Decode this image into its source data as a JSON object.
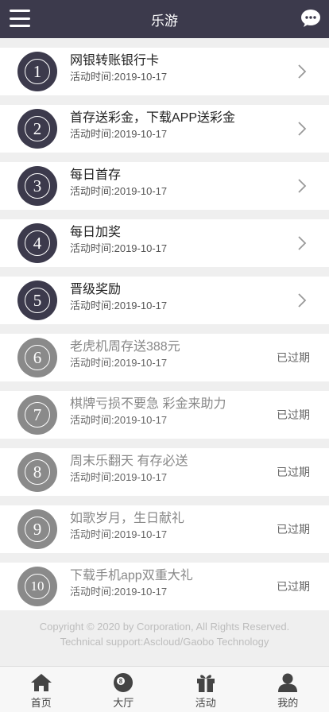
{
  "header": {
    "title": "乐游",
    "menu_icon": "menu-icon",
    "chat_icon": "chat-bubble-icon"
  },
  "promotions": [
    {
      "number": "1",
      "title": "网银转账银行卡",
      "date": "活动时间:2019-10-17",
      "status": "active"
    },
    {
      "number": "2",
      "title": "首存送彩金，下载APP送彩金",
      "date": "活动时间:2019-10-17",
      "status": "active"
    },
    {
      "number": "3",
      "title": "每日首存",
      "date": "活动时间:2019-10-17",
      "status": "active"
    },
    {
      "number": "4",
      "title": "每日加奖",
      "date": "活动时间:2019-10-17",
      "status": "active"
    },
    {
      "number": "5",
      "title": "晋级奖励",
      "date": "活动时间:2019-10-17",
      "status": "active"
    },
    {
      "number": "6",
      "title": "老虎机周存送388元",
      "date": "活动时间:2019-10-17",
      "status": "expired",
      "badge": "已过期"
    },
    {
      "number": "7",
      "title": "棋牌亏损不要急 彩金来助力",
      "date": "活动时间:2019-10-17",
      "status": "expired",
      "badge": "已过期"
    },
    {
      "number": "8",
      "title": "周末乐翻天 有存必送",
      "date": "活动时间:2019-10-17",
      "status": "expired",
      "badge": "已过期"
    },
    {
      "number": "9",
      "title": "如歌岁月，生日献礼",
      "date": "活动时间:2019-10-17",
      "status": "expired",
      "badge": "已过期"
    },
    {
      "number": "10",
      "title": "下载手机app双重大礼",
      "date": "活动时间:2019-10-17",
      "status": "expired",
      "badge": "已过期"
    }
  ],
  "footer": {
    "copyright": "Copyright © 2020 by Corporation, All Rights Reserved.",
    "support": "Technical support:Ascloud/Gaobo Technology"
  },
  "tabs": [
    {
      "label": "首页",
      "icon": "home-icon"
    },
    {
      "label": "大厅",
      "icon": "billiard-ball-icon"
    },
    {
      "label": "活动",
      "icon": "gift-icon"
    },
    {
      "label": "我的",
      "icon": "user-icon"
    }
  ],
  "colors": {
    "header_bg": "#3c3a4c",
    "active_circle": "#3c3a4c",
    "expired_circle": "#8a8a8a"
  }
}
